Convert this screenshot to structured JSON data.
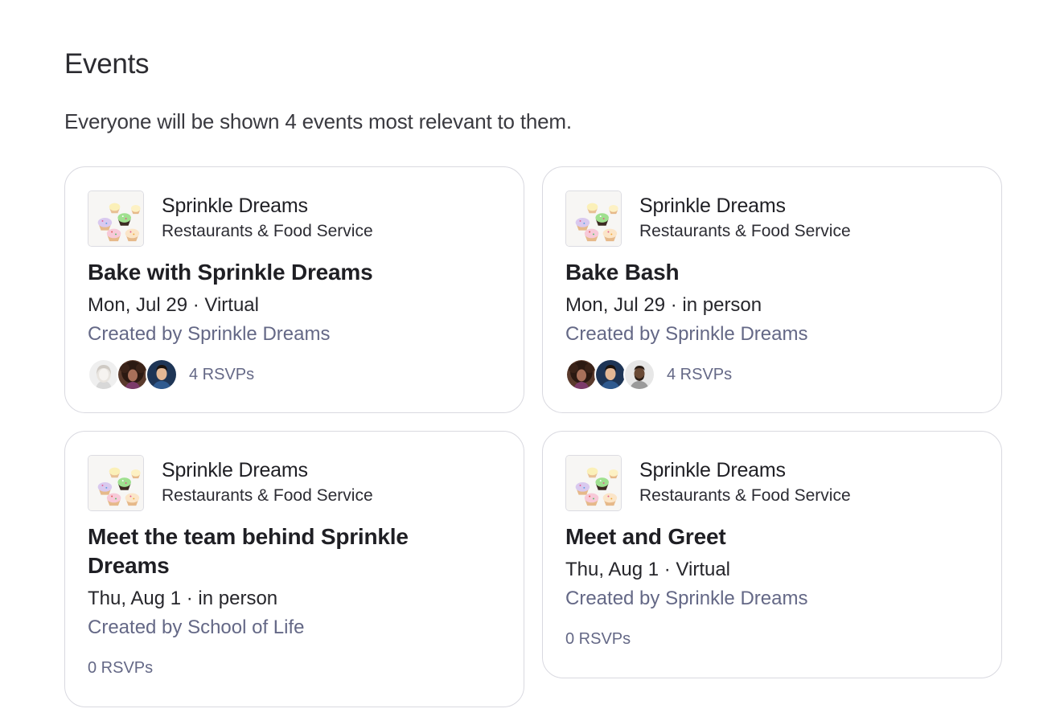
{
  "section": {
    "title": "Events",
    "description": "Everyone will be shown 4 events most relevant to them."
  },
  "colors": {
    "creator_text": "#646886",
    "card_border": "#d9d9e0"
  },
  "events": [
    {
      "org_name": "Sprinkle Dreams",
      "org_category": "Restaurants & Food Service",
      "org_logo_icon": "cupcakes-logo",
      "title": "Bake with Sprinkle Dreams",
      "when": "Mon, Jul 29 · Virtual",
      "creator": "Created by Sprinkle Dreams",
      "rsvp_count": "4 RSVPs",
      "avatars": [
        "blonde-woman-avatar",
        "curly-hair-woman-avatar",
        "man-blue-shirt-avatar"
      ]
    },
    {
      "org_name": "Sprinkle Dreams",
      "org_category": "Restaurants & Food Service",
      "org_logo_icon": "cupcakes-logo",
      "title": "Bake Bash",
      "when": "Mon, Jul 29 · in person",
      "creator": "Created by Sprinkle Dreams",
      "rsvp_count": "4 RSVPs",
      "avatars": [
        "curly-hair-woman-avatar",
        "man-blue-shirt-avatar",
        "bearded-man-avatar"
      ]
    },
    {
      "org_name": "Sprinkle Dreams",
      "org_category": "Restaurants & Food Service",
      "org_logo_icon": "cupcakes-logo",
      "title": "Meet the team behind Sprinkle Dreams",
      "when": "Thu, Aug 1 · in person",
      "creator": "Created by School of Life",
      "rsvp_count": "0 RSVPs",
      "avatars": []
    },
    {
      "org_name": "Sprinkle Dreams",
      "org_category": "Restaurants & Food Service",
      "org_logo_icon": "cupcakes-logo",
      "title": "Meet and Greet",
      "when": "Thu, Aug 1 · Virtual",
      "creator": "Created by Sprinkle Dreams",
      "rsvp_count": "0 RSVPs",
      "avatars": []
    }
  ]
}
